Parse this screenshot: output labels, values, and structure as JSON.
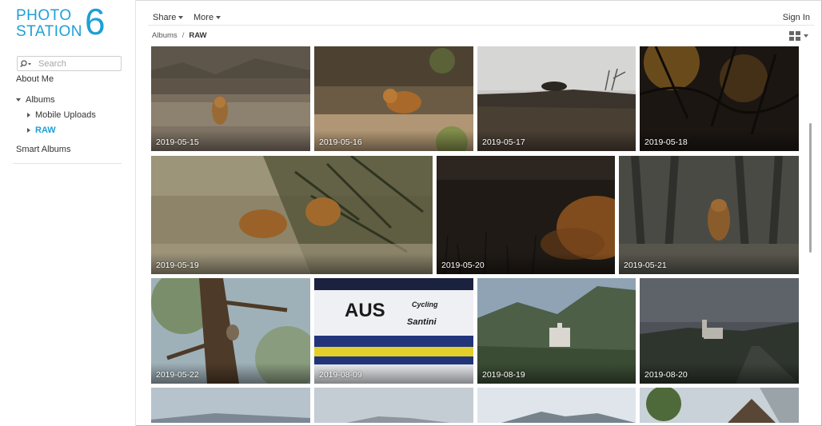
{
  "app": {
    "logo_line1": "PHOTO",
    "logo_line2": "STATION",
    "logo_number": "6",
    "accent_color": "#1e9fd8"
  },
  "search": {
    "placeholder": "Search",
    "icon": "search-icon"
  },
  "sidebar": {
    "about_me": "About Me",
    "albums": "Albums",
    "mobile_uploads": "Mobile Uploads",
    "raw": "RAW",
    "smart_albums": "Smart Albums"
  },
  "toolbar": {
    "share": "Share",
    "more": "More",
    "sign_in": "Sign In"
  },
  "breadcrumb": {
    "root": "Albums",
    "separator": "/",
    "current": "RAW"
  },
  "photos": [
    {
      "date": "2019-05-15"
    },
    {
      "date": "2019-05-16"
    },
    {
      "date": "2019-05-17"
    },
    {
      "date": "2019-05-18"
    },
    {
      "date": "2019-05-19"
    },
    {
      "date": "2019-05-20"
    },
    {
      "date": "2019-05-21"
    },
    {
      "date": "2019-05-22"
    },
    {
      "date": "2019-08-09"
    },
    {
      "date": "2019-08-19"
    },
    {
      "date": "2019-08-20"
    }
  ]
}
